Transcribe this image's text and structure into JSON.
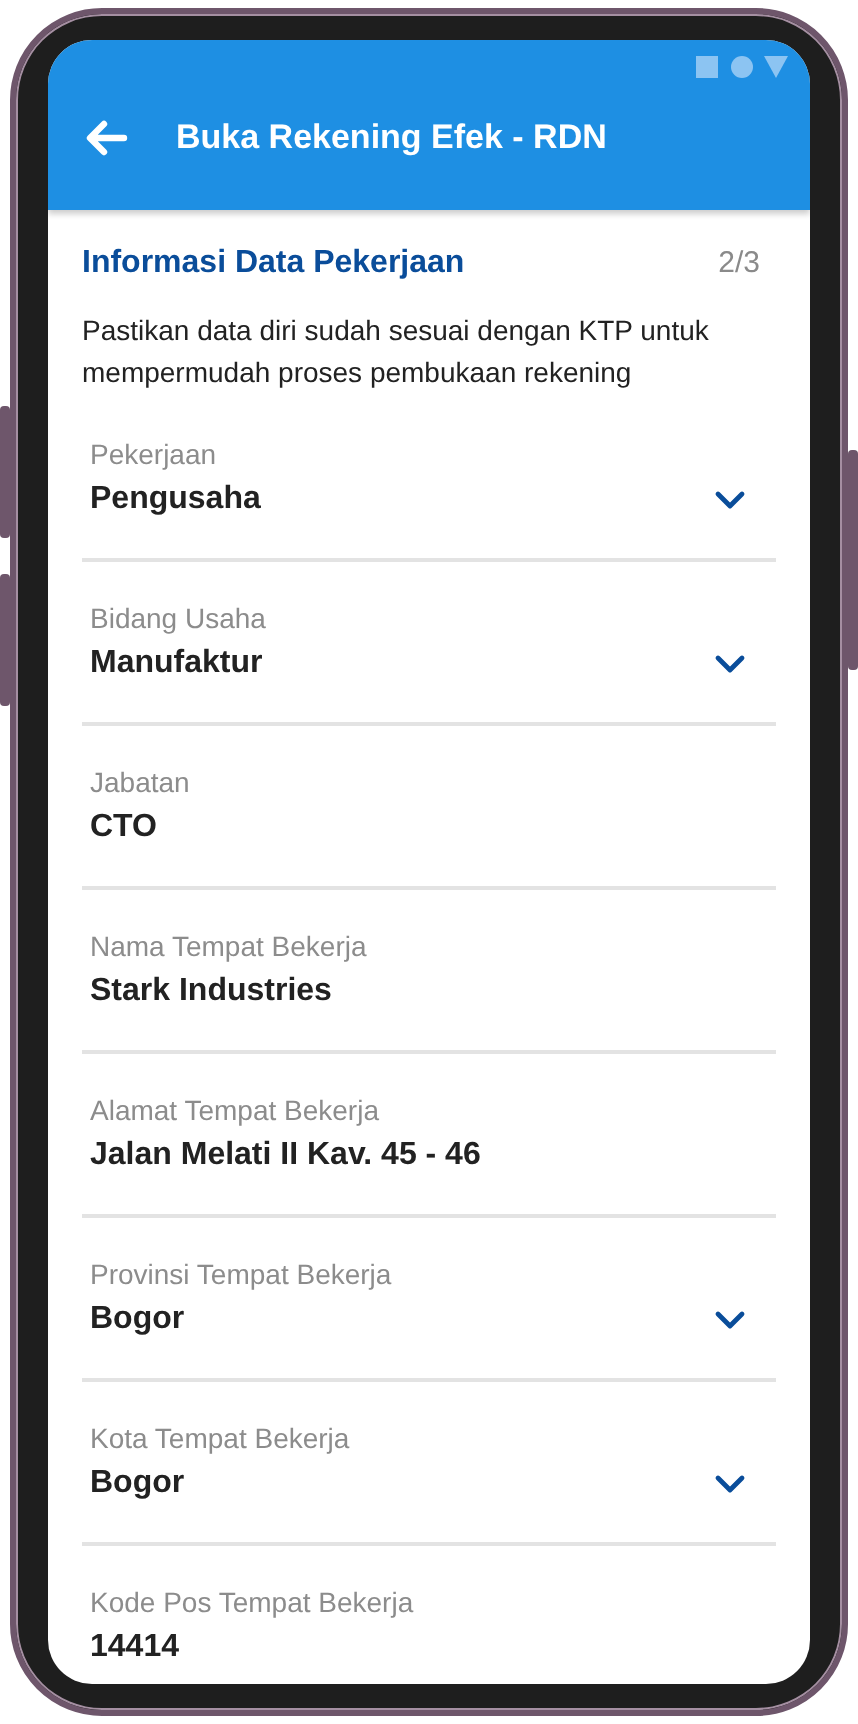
{
  "app_bar": {
    "title": "Buka Rekening Efek - RDN"
  },
  "section": {
    "title": "Informasi Data Pekerjaan",
    "step": "2/3",
    "description": "Pastikan data diri sudah sesuai dengan KTP untuk mempermudah proses pembukaan rekening"
  },
  "fields": [
    {
      "kind": "dropdown",
      "label": "Pekerjaan",
      "value": "Pengusaha"
    },
    {
      "kind": "dropdown",
      "label": "Bidang Usaha",
      "value": "Manufaktur"
    },
    {
      "kind": "text",
      "label": "Jabatan",
      "value": "CTO"
    },
    {
      "kind": "text",
      "label": "Nama Tempat Bekerja",
      "value": "Stark Industries"
    },
    {
      "kind": "text",
      "label": "Alamat Tempat Bekerja",
      "value": "Jalan Melati II Kav. 45 - 46"
    },
    {
      "kind": "dropdown",
      "label": "Provinsi Tempat Bekerja",
      "value": "Bogor"
    },
    {
      "kind": "dropdown",
      "label": "Kota Tempat Bekerja",
      "value": "Bogor"
    },
    {
      "kind": "text",
      "label": "Kode Pos Tempat Bekerja",
      "value": "14414"
    }
  ]
}
